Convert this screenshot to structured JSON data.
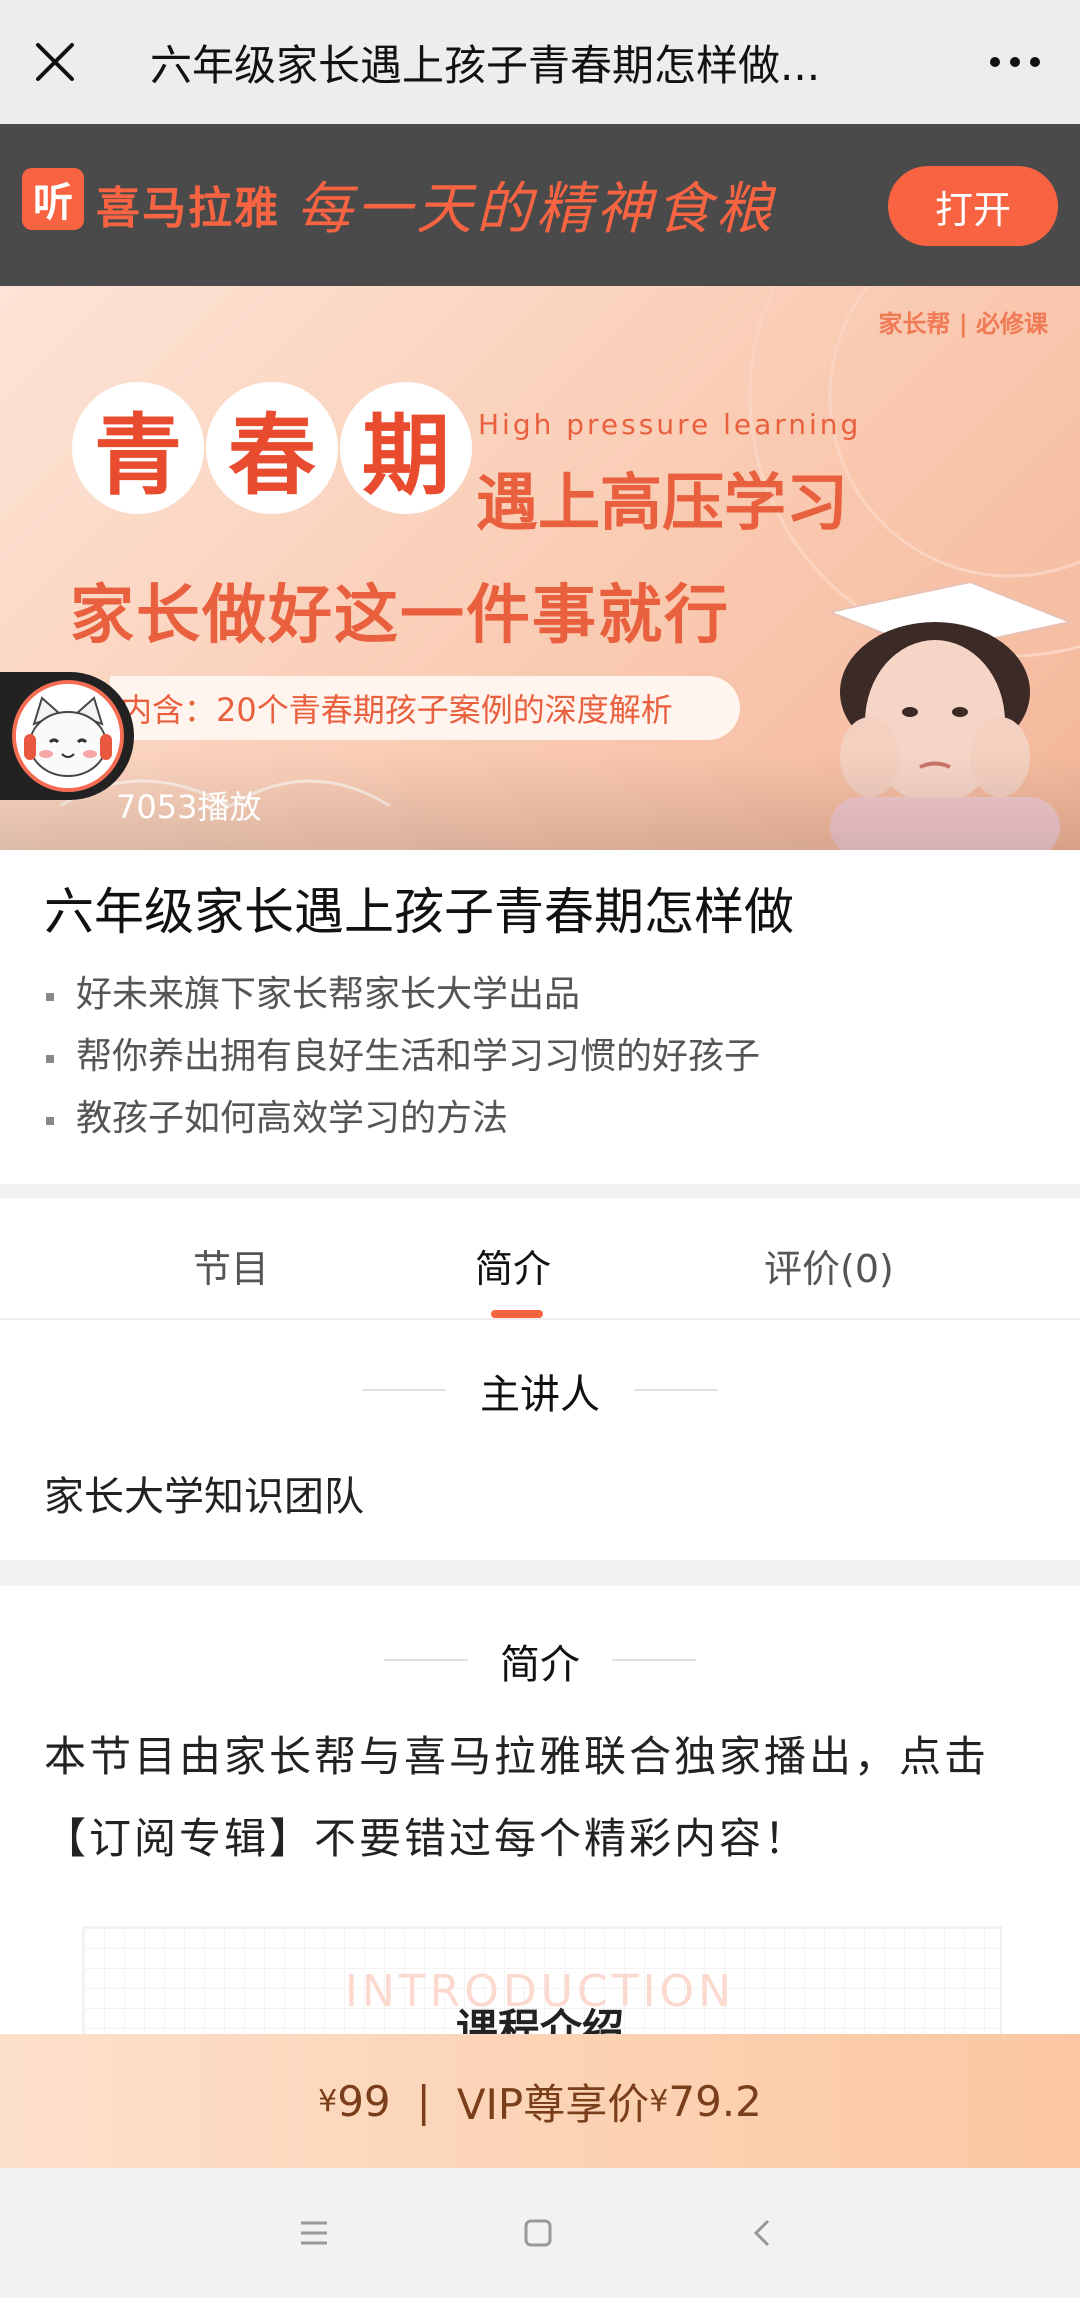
{
  "header": {
    "title": "六年级家长遇上孩子青春期怎样做..."
  },
  "promo": {
    "logo_glyph": "听",
    "brand": "喜马拉雅",
    "slogan": "每一天的精神食粮",
    "open_label": "打开",
    "accent_color": "#f86442"
  },
  "banner": {
    "corner_logo": "家长帮 | 必修课",
    "title_chars": [
      "青",
      "春",
      "期"
    ],
    "english": "High   pressure   learning",
    "subtitle1": "遇上高压学习",
    "subtitle2": "家长做好这一件事就行",
    "contains": "内含：20个青春期孩子案例的深度解析",
    "play_count": "7053播放"
  },
  "album": {
    "title": "六年级家长遇上孩子青春期怎样做",
    "bullets": [
      "好未来旗下家长帮家长大学出品",
      "帮你养出拥有良好生活和学习习惯的好孩子",
      "教孩子如何高效学习的方法"
    ]
  },
  "tabs": [
    {
      "label": "节目"
    },
    {
      "label": "简介"
    },
    {
      "label": "评价(0)"
    }
  ],
  "lecturer": {
    "heading": "主讲人",
    "name": "家长大学知识团队"
  },
  "intro": {
    "heading": "简介",
    "description": "本节目由家长帮与喜马拉雅联合独家播出，点击【订阅专辑】不要错过每个精彩内容！",
    "card_english": "INTRODUCTION",
    "card_heading": "课程介绍"
  },
  "buy": {
    "yen": "¥",
    "price": "99",
    "separator": "|",
    "vip_label": "VIP尊享价",
    "vip_price": "79.2"
  }
}
